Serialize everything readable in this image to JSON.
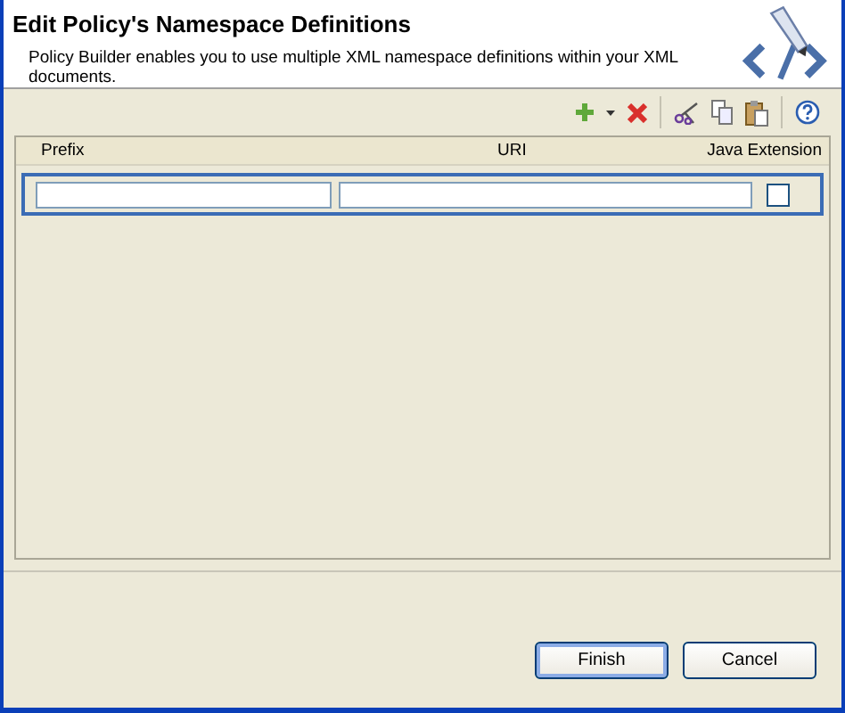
{
  "header": {
    "title": "Edit Policy's Namespace Definitions",
    "description": "Policy Builder enables you to use multiple XML namespace definitions within your XML documents."
  },
  "table": {
    "columns": [
      "Prefix",
      "URI",
      "Java Extension"
    ],
    "rows": [
      {
        "selected": true,
        "java_extension": false
      }
    ]
  },
  "buttons": [
    {
      "label": "Finish",
      "default": true
    },
    {
      "label": "Cancel",
      "default": false
    }
  ]
}
